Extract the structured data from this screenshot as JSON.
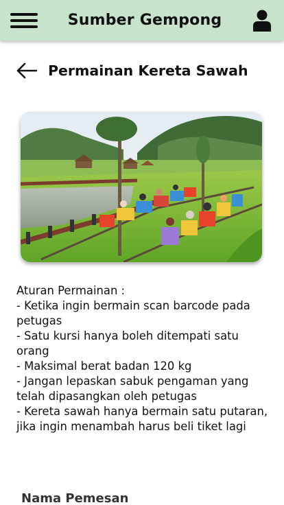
{
  "header": {
    "app_title": "Sumber Gempong",
    "menu_icon": "hamburger-menu-icon",
    "profile_icon": "user-icon",
    "background": "#c8e3cb"
  },
  "page": {
    "title": "Permainan Kereta Sawah",
    "back_icon": "arrow-left-icon"
  },
  "hero_image": {
    "subject": "rice-field train ride"
  },
  "rules": {
    "heading": "Aturan Permainan :",
    "items": [
      "- Ketika ingin bermain scan barcode pada petugas",
      "- Satu kursi hanya boleh ditempati satu orang",
      "- Maksimal berat badan 120 kg",
      "- Jangan lepaskan sabuk pengaman yang telah dipasangkan oleh petugas",
      "- Kereta sawah hanya bermain satu putaran, jika ingin menambah harus beli tiket lagi"
    ]
  },
  "form": {
    "name_label": "Nama Pemesan"
  }
}
